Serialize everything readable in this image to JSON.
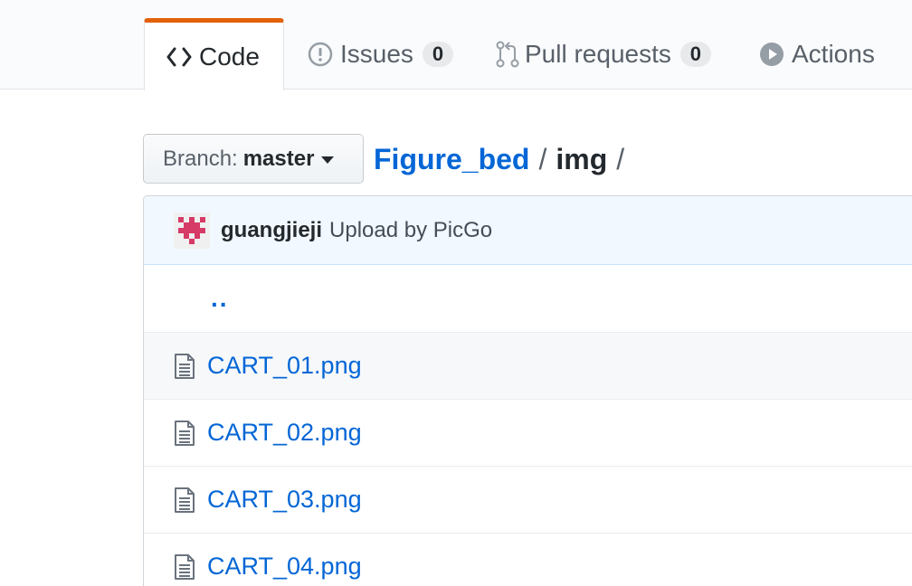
{
  "tabs": [
    {
      "label": "Code",
      "icon": "code-icon",
      "selected": true
    },
    {
      "label": "Issues",
      "icon": "issue-opened-icon",
      "count": "0"
    },
    {
      "label": "Pull requests",
      "icon": "git-pull-request-icon",
      "count": "0"
    },
    {
      "label": "Actions",
      "icon": "play-icon"
    }
  ],
  "branch": {
    "prefix": "Branch:",
    "name": "master"
  },
  "breadcrumb": {
    "repo": "Figure_bed",
    "separator": "/",
    "dir": "img",
    "trailing": "/"
  },
  "commit": {
    "author": "guangjieji",
    "message": "Upload by PicGo",
    "avatar_color": "#d63a67"
  },
  "files": {
    "parent": "..",
    "items": [
      {
        "name": "CART_01.png"
      },
      {
        "name": "CART_02.png"
      },
      {
        "name": "CART_03.png"
      },
      {
        "name": "CART_04.png"
      }
    ]
  },
  "colors": {
    "accent": "#e36209",
    "link": "#0366d6"
  }
}
